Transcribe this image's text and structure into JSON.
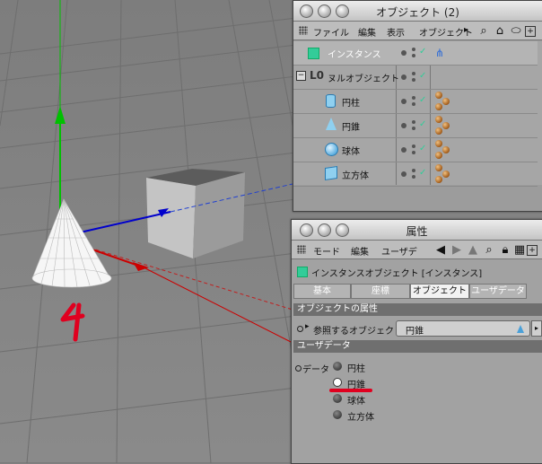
{
  "viewport": {
    "annotation": "4"
  },
  "object_manager": {
    "title": "オブジェクト (2)",
    "menu": [
      "ファイル",
      "編集",
      "表示",
      "オブジェクト"
    ],
    "icons": [
      "magnifier-icon",
      "home-icon",
      "ellipse-icon",
      "new-window-icon"
    ],
    "objects": [
      {
        "name": "インスタンス",
        "icon": "instance-icon",
        "tag": "hierarchy-tag"
      },
      {
        "name": "ヌルオブジェクト",
        "icon": "null-object-icon",
        "expander": "−"
      },
      {
        "name": "円柱",
        "icon": "cylinder-icon",
        "tag": "material-balls"
      },
      {
        "name": "円錐",
        "icon": "cone-icon",
        "tag": "material-balls"
      },
      {
        "name": "球体",
        "icon": "sphere-icon",
        "tag": "material-balls"
      },
      {
        "name": "立方体",
        "icon": "cube-icon",
        "tag": "material-balls"
      }
    ]
  },
  "attributes": {
    "title": "属性",
    "menu": [
      "モード",
      "編集",
      "ユーザデ"
    ],
    "object_title": "インスタンスオブジェクト [インスタンス]",
    "tabs": [
      "基本",
      "座標",
      "オブジェクト",
      "ユーザデータ"
    ],
    "active_tab": "オブジェクト",
    "section_object": "オブジェクトの属性",
    "ref_label": "参照するオブジェクト",
    "ref_value": "円錐",
    "section_user": "ユーザデータ",
    "data_label": "データ",
    "options": [
      "円柱",
      "円錐",
      "球体",
      "立方体"
    ],
    "selected": "円錐"
  },
  "colors": {
    "accent_red": "#e0001f",
    "check_green": "#33cc99",
    "axis_green": "#00c000",
    "axis_blue": "#0000cc",
    "axis_red": "#cc0000"
  }
}
